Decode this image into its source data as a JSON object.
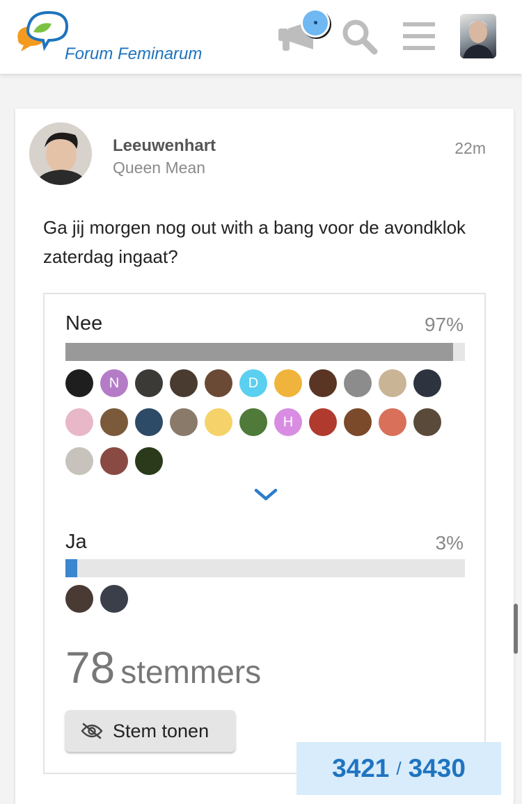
{
  "header": {
    "logo_text": "Forum Feminarum",
    "icons": [
      "megaphone-icon",
      "search-icon",
      "hamburger-menu-icon"
    ],
    "notification_color": "#6fb8f2"
  },
  "post": {
    "username": "Leeuwenhart",
    "user_title": "Queen Mean",
    "time": "22m",
    "text": "Ga jij morgen nog out with a bang voor de avondklok zaterdag ingaat?"
  },
  "poll": {
    "options": [
      {
        "label": "Nee",
        "percent_text": "97%",
        "percent": 97,
        "bar_color": "#999999",
        "voters": [
          {
            "letter": "",
            "color": "#1e1e1e"
          },
          {
            "letter": "N",
            "color": "#b47cc7"
          },
          {
            "letter": "",
            "color": "#3c3a36"
          },
          {
            "letter": "",
            "color": "#4a3b30"
          },
          {
            "letter": "",
            "color": "#6b4a35"
          },
          {
            "letter": "D",
            "color": "#5bcff0"
          },
          {
            "letter": "",
            "color": "#f0b43c"
          },
          {
            "letter": "",
            "color": "#5a3524"
          },
          {
            "letter": "",
            "color": "#8c8c8c"
          },
          {
            "letter": "",
            "color": "#c9b496"
          },
          {
            "letter": "",
            "color": "#2d3440"
          },
          {
            "letter": "",
            "color": "#e8b7c8"
          },
          {
            "letter": "",
            "color": "#7a5a3a"
          },
          {
            "letter": "",
            "color": "#2d4a66"
          },
          {
            "letter": "",
            "color": "#8a7a6a"
          },
          {
            "letter": "",
            "color": "#f5d36a"
          },
          {
            "letter": "",
            "color": "#4f7a3a"
          },
          {
            "letter": "H",
            "color": "#d88de3"
          },
          {
            "letter": "",
            "color": "#b03a2e"
          },
          {
            "letter": "",
            "color": "#7a4a2a"
          },
          {
            "letter": "",
            "color": "#d8705a"
          },
          {
            "letter": "",
            "color": "#5a4a3a"
          },
          {
            "letter": "",
            "color": "#c7c2bb"
          },
          {
            "letter": "",
            "color": "#8a4a44"
          },
          {
            "letter": "",
            "color": "#2a3a1a"
          }
        ]
      },
      {
        "label": "Ja",
        "percent_text": "3%",
        "percent": 3,
        "bar_color": "#3a86cf",
        "voters": [
          {
            "letter": "",
            "color": "#4a3a34"
          },
          {
            "letter": "",
            "color": "#3a3f4a"
          }
        ]
      }
    ],
    "voter_count": "78",
    "voter_label": "stemmers",
    "show_votes_button": "Stem tonen"
  },
  "pagination": {
    "current": "3421",
    "separator": "/",
    "total": "3430"
  }
}
